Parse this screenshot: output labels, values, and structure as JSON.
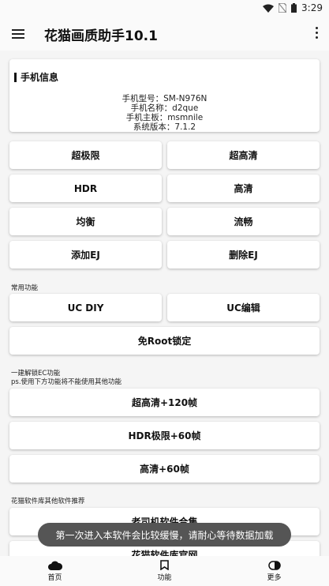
{
  "status_bar": {
    "time": "3:29"
  },
  "app_bar": {
    "title": "花猫画质助手10.1"
  },
  "phone_info": {
    "title": "手机信息",
    "model": "手机型号：SM-N976N",
    "name": "手机名称：d2que",
    "board": "手机主板：msmnile",
    "version": "系统版本：7.1.2"
  },
  "quality_buttons": [
    [
      "超极限",
      "超高清"
    ],
    [
      "HDR",
      "高清"
    ],
    [
      "均衡",
      "流畅"
    ],
    [
      "添加EJ",
      "删除EJ"
    ]
  ],
  "common": {
    "label": "常用功能",
    "uc_diy": "UC DIY",
    "uc_edit": "UC编辑",
    "noroot_lock": "免Root锁定"
  },
  "ec": {
    "label_line1": "一建解锁EC功能",
    "label_line2": "ps.使用下方功能将不能使用其他功能",
    "buttons": [
      "超高清+120帧",
      "HDR极限+60帧",
      "高清+60帧"
    ]
  },
  "recommend": {
    "label": "花猫软件库其他软件推荐",
    "buttons": [
      "老司机软件合集",
      "花猫软件库官网"
    ]
  },
  "toast": "第一次进入本软件会比较缓慢，请耐心等待数据加载",
  "bottom_nav": [
    {
      "label": "首页",
      "icon": "cloud-icon"
    },
    {
      "label": "功能",
      "icon": "bookmark-icon"
    },
    {
      "label": "更多",
      "icon": "contrast-icon"
    }
  ]
}
